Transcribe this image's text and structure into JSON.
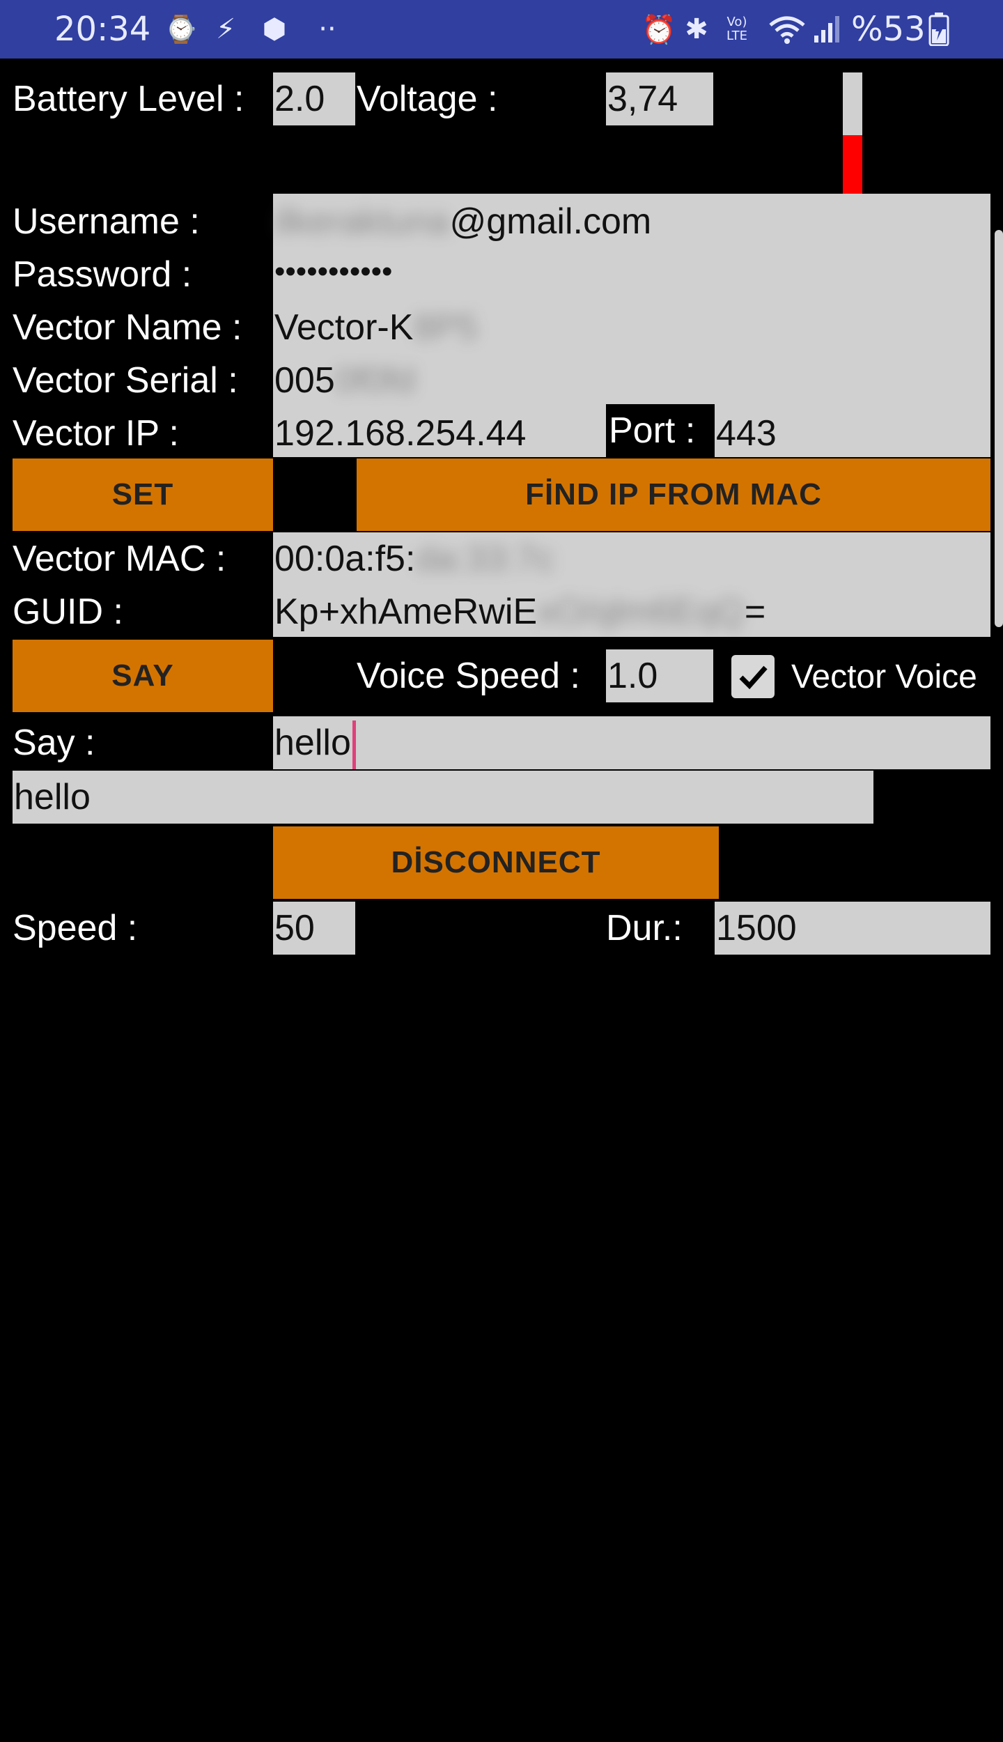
{
  "status_bar": {
    "time": "20:34",
    "battery_text": "%53",
    "left_icons": [
      "watch-icon",
      "flash-icon",
      "hexagon-icon",
      "more-dots-icon"
    ],
    "right_icons": [
      "alarm-icon",
      "bluetooth-icon",
      "volte-icon",
      "wifi-icon",
      "signal-icon",
      "battery-icon"
    ],
    "volte_text": "Vo) LTE"
  },
  "battery": {
    "label": "Battery Level :",
    "value": "2.0",
    "voltage_label": "Voltage :",
    "voltage_value": "3,74",
    "level_fraction": 0.48,
    "level_color": "#ff0000"
  },
  "credentials": {
    "username_label": "Username :",
    "username_hidden": "ilkeraktuna",
    "username_suffix": "@gmail.com",
    "password_label": "Password :",
    "password_value": "•••••••••••"
  },
  "vector": {
    "name_label": "Vector Name :",
    "name_prefix": "Vector-K",
    "name_hidden": "8P5",
    "serial_label": "Vector Serial :",
    "serial_prefix": "005",
    "serial_hidden": "0f0fd",
    "ip_label": "Vector IP :",
    "ip_value": "192.168.254.44",
    "port_label": "Port :",
    "port_value": "443",
    "mac_label": "Vector MAC :",
    "mac_prefix": "00:0a:f5:",
    "mac_hidden": "da:33:7c",
    "guid_label": "GUID :",
    "guid_prefix": "Kp+xhAmeRwiE",
    "guid_hidden": "xO/qlm6EqQ",
    "guid_suffix": "="
  },
  "buttons": {
    "set": "SET",
    "find_ip": "FİND IP FROM MAC",
    "say": "SAY",
    "disconnect": "DİSCONNECT"
  },
  "voice": {
    "speed_label": "Voice Speed :",
    "speed_value": "1.0",
    "vector_voice_label": "Vector Voice",
    "vector_voice_checked": true
  },
  "say": {
    "label": "Say :",
    "input_value": "hello",
    "output_text": "hello"
  },
  "motion": {
    "speed_label": "Speed :",
    "speed_value": "50",
    "dur_label": "Dur.:",
    "dur_value": "1500"
  },
  "colors": {
    "status_bar": "#303fa0",
    "button": "#d47400",
    "field": "#d0d0d0",
    "cursor": "#e0407a"
  }
}
